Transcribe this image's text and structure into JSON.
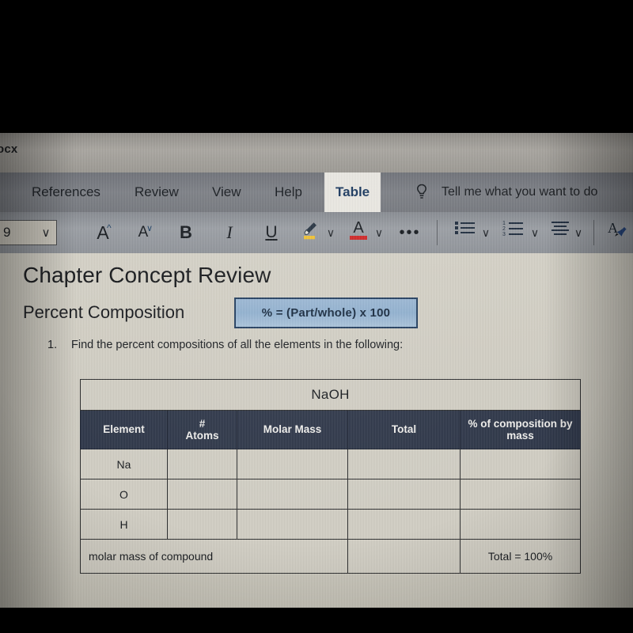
{
  "window": {
    "filename_fragment": "ocx"
  },
  "ribbon": {
    "tabs": [
      {
        "label": "References",
        "active": false
      },
      {
        "label": "Review",
        "active": false
      },
      {
        "label": "View",
        "active": false
      },
      {
        "label": "Help",
        "active": false
      },
      {
        "label": "Table",
        "active": true
      }
    ],
    "tell_me": {
      "icon": "lightbulb-icon",
      "placeholder": "Tell me what you want to do"
    },
    "toolbar": {
      "font_size_value": "9",
      "caret_glyph": "∨",
      "grow_font_label": "A",
      "shrink_font_label": "A",
      "bold_label": "B",
      "italic_label": "I",
      "underline_label": "U",
      "highlight_label": "✐",
      "font_color_label": "A",
      "more_label": "•••",
      "bullet_list_label": "bullets",
      "numbered_list_label": "numbering",
      "align_label": "align",
      "format_painter_label": "A",
      "highlight_color": "#f2c230",
      "font_color": "#cf2323",
      "active_tab_text_color": "#17365d"
    }
  },
  "document": {
    "heading": "Chapter Concept Review",
    "subheading": "Percent Composition",
    "formula": "% = (Part/whole) x 100",
    "question_number": "1.",
    "question_text": "Find the percent compositions of all the elements in the following:",
    "table": {
      "compound_title": "NaOH",
      "headers": [
        "Element",
        "#\nAtoms",
        "Molar Mass",
        "Total",
        "% of composition by\nmass"
      ],
      "header_lines": [
        [
          "Element"
        ],
        [
          "#",
          "Atoms"
        ],
        [
          "Molar Mass"
        ],
        [
          "Total"
        ],
        [
          "% of composition by",
          "mass"
        ]
      ],
      "rows": [
        {
          "element": "Na",
          "atoms": "",
          "molar_mass": "",
          "total": "",
          "percent": ""
        },
        {
          "element": "O",
          "atoms": "",
          "molar_mass": "",
          "total": "",
          "percent": ""
        },
        {
          "element": "H",
          "atoms": "",
          "molar_mass": "",
          "total": "",
          "percent": ""
        }
      ],
      "footer": {
        "label": "molar mass of compound",
        "middle": "",
        "total": "Total = 100%"
      },
      "header_bg": "#2b3446",
      "cell_bg": "#d2cfc4"
    }
  }
}
